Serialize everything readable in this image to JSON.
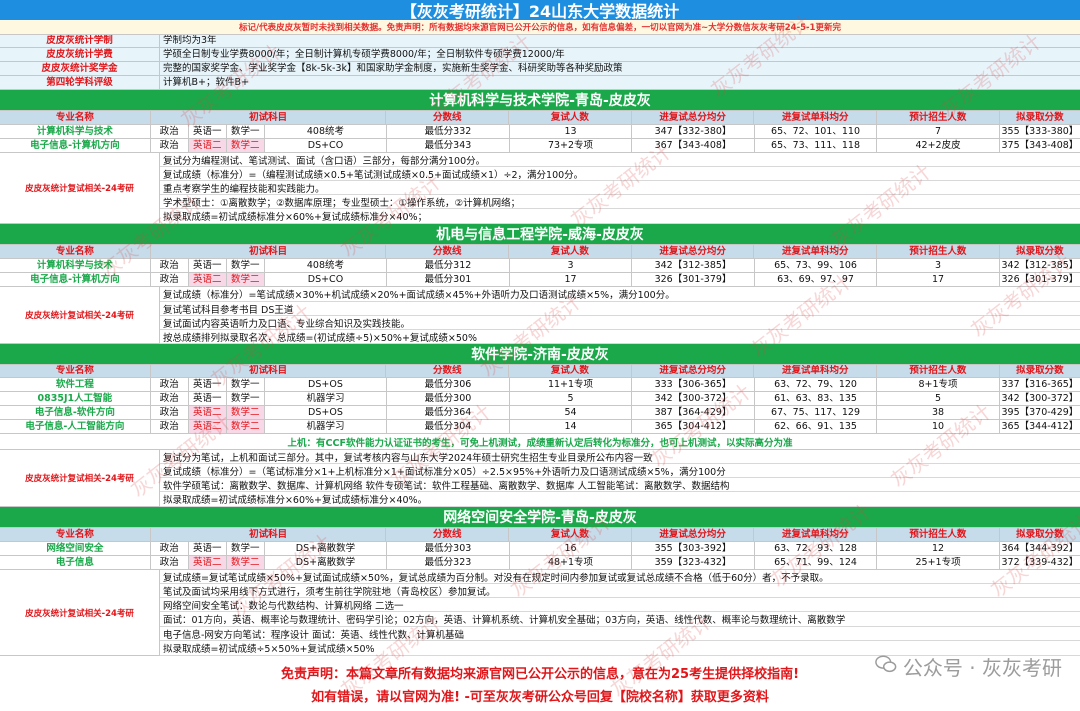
{
  "title": "【灰灰考研统计】24山东大学数据统计",
  "notice": "标记/代表皮皮灰暂时未找到相关数据。免责声明：所有数据均来源官网已公开公示的信息，如有信息偏差，一切以官网为准~大学分数信灰灰考研24-5-1更新完",
  "info": [
    {
      "label": "皮皮灰统计学制",
      "value": "学制均为3年"
    },
    {
      "label": "皮皮灰统计学费",
      "value": "学硕全日制专业学费8000/年；全日制计算机专硕学费8000/年；全日制软件专硕学费12000/年"
    },
    {
      "label": "皮皮灰统计奖学金",
      "value": "完整的国家奖学金、学业奖学金【8k-5k-3k】和国家助学金制度，实施新生奖学金、科研奖助等各种奖励政策"
    },
    {
      "label": "第四轮学科评级",
      "value": "计算机B+；软件B+"
    }
  ],
  "headers": {
    "major": "专业名称",
    "exam": "初试科目",
    "line": "分数线",
    "retest_count": "复试人数",
    "total_avg": "进复试总分均分",
    "single_avg": "进复试单科均分",
    "plan": "预计招生人数",
    "admit": "拟录取分数"
  },
  "retest_label": "皮皮灰统计复试相关-24考研",
  "sections": [
    {
      "title": "计算机科学与技术学院-青岛-皮皮灰",
      "rows": [
        {
          "major": "计算机科学与技术",
          "s1": "政治",
          "s2": "英语一",
          "s3": "数学一",
          "s4": "408统考",
          "line": "最低分332",
          "count": "13",
          "total": "347【332-380】",
          "single": "65、72、101、110",
          "plan": "7",
          "admit": "355【333-380】",
          "pink": false
        },
        {
          "major": "电子信息-计算机方向",
          "s1": "政治",
          "s2": "英语二",
          "s3": "数学二",
          "s4": "DS+CO",
          "line": "最低分343",
          "count": "73+2专项",
          "total": "367【343-408】",
          "single": "65、73、111、118",
          "plan": "42+2皮皮",
          "admit": "375【343-408】",
          "pink": true
        }
      ],
      "retest": [
        "复试分为编程测试、笔试测试、面试（含口语）三部分，每部分满分100分。",
        "复试成绩（标准分）=（编程测试成绩×0.5+笔试测试成绩×0.5+面试成绩×1）÷2，满分100分。",
        "重点考察学生的编程技能和实践能力。",
        "学术型硕士：①离散数学；②数据库原理；专业型硕士：①操作系统，②计算机网络；",
        "拟录取成绩=初试成绩标准分×60%+复试成绩标准分×40%；"
      ],
      "note": ""
    },
    {
      "title": "机电与信息工程学院-威海-皮皮灰",
      "rows": [
        {
          "major": "计算机科学与技术",
          "s1": "政治",
          "s2": "英语一",
          "s3": "数学一",
          "s4": "408统考",
          "line": "最低分312",
          "count": "3",
          "total": "342【312-385】",
          "single": "65、73、99、106",
          "plan": "3",
          "admit": "342【312-385】",
          "pink": false
        },
        {
          "major": "电子信息-计算机方向",
          "s1": "政治",
          "s2": "英语二",
          "s3": "数学二",
          "s4": "DS+CO",
          "line": "最低分301",
          "count": "17",
          "total": "326【301-379】",
          "single": "63、69、97、97",
          "plan": "17",
          "admit": "326【301-379】",
          "pink": true
        }
      ],
      "retest": [
        "复试成绩（标准分）=笔试成绩×30%+机试成绩×20%+面试成绩×45%+外语听力及口语测试成绩×5%，满分100分。",
        "复试笔试科目参考书目 DS王道",
        "复试面试内容英语听力及口语、专业综合知识及实践技能。",
        "按总成绩排列拟录取名次，总成绩=(初试成绩÷5)×50%+复试成绩×50%"
      ],
      "note": ""
    },
    {
      "title": "软件学院-济南-皮皮灰",
      "rows": [
        {
          "major": "软件工程",
          "s1": "政治",
          "s2": "英语一",
          "s3": "数学一",
          "s4": "DS+OS",
          "line": "最低分306",
          "count": "11+1专项",
          "total": "333【306-365】",
          "single": "63、72、79、120",
          "plan": "8+1专项",
          "admit": "337【316-365】",
          "pink": false
        },
        {
          "major": "0835J1人工智能",
          "s1": "政治",
          "s2": "英语一",
          "s3": "数学一",
          "s4": "机器学习",
          "line": "最低分300",
          "count": "5",
          "total": "342【300-372】",
          "single": "61、63、83、135",
          "plan": "5",
          "admit": "342【300-372】",
          "pink": false
        },
        {
          "major": "电子信息-软件方向",
          "s1": "政治",
          "s2": "英语二",
          "s3": "数学二",
          "s4": "DS+OS",
          "line": "最低分364",
          "count": "54",
          "total": "387【364-429】",
          "single": "67、75、117、129",
          "plan": "38",
          "admit": "395【370-429】",
          "pink": true
        },
        {
          "major": "电子信息-人工智能方向",
          "s1": "政治",
          "s2": "英语二",
          "s3": "数学二",
          "s4": "机器学习",
          "line": "最低分304",
          "count": "14",
          "total": "365【304-412】",
          "single": "62、66、91、135",
          "plan": "10",
          "admit": "365【344-412】",
          "pink": true
        }
      ],
      "note": "上机：有CCF软件能力认证证书的考生，可免上机测试，成绩重新认定后转化为标准分，也可上机测试，以实际高分为准",
      "retest": [
        "复试分为笔试，上机和面试三部分。其中，复试考核内容与山东大学2024年硕士研究生招生专业目录所公布内容一致",
        "复试成绩（标准分）=（笔试标准分×1+上机标准分×1+面试标准分×05）÷2.5×95%+外语听力及口语测试成绩×5%，满分100分",
        "软件学硕笔试：离散数学、数据库、计算机网络     软件专硕笔试：软件工程基础、离散数学、数据库     人工智能笔试：离散数学、数据结构",
        "拟录取成绩=初试成绩标准分×60%+复试成绩标准分×40%。"
      ]
    },
    {
      "title": "网络空间安全学院-青岛-皮皮灰",
      "rows": [
        {
          "major": "网络空间安全",
          "s1": "政治",
          "s2": "英语一",
          "s3": "数学一",
          "s4": "DS+离散数学",
          "line": "最低分303",
          "count": "16",
          "total": "355【303-392】",
          "single": "63、72、93、128",
          "plan": "12",
          "admit": "364【344-392】",
          "pink": false
        },
        {
          "major": "电子信息",
          "s1": "政治",
          "s2": "英语二",
          "s3": "数学二",
          "s4": "DS+离散数学",
          "line": "最低分323",
          "count": "48+1专项",
          "total": "359【323-432】",
          "single": "65、71、99、124",
          "plan": "25+1专项",
          "admit": "372【339-432】",
          "pink": true
        }
      ],
      "retest": [
        "复试成绩=复试笔试成绩×50%+复试面试成绩×50%，复试总成绩为百分制。对没有在规定时间内参加复试或复试总成绩不合格（低于60分）者，不予录取。",
        "笔试及面试均采用线下方式进行，须考生前往学院驻地（青岛校区）参加复试。",
        "网络空间安全笔试：数论与代数结构、计算机网络 二选一",
        "面试：01方向，英语、概率论与数理统计、密码学引论；02方向，英语、计算机系统、计算机安全基础；03方向，英语、线性代数、概率论与数理统计、离散数学",
        "电子信息-网安方向笔试：程序设计 面试：英语、线性代数、计算机基础",
        "拟录取成绩=初试成绩÷5×50%+复试成绩×50%"
      ],
      "note": ""
    }
  ],
  "footer": {
    "line1": "免责声明：本篇文章所有数据均来源官网已公开公示的信息，意在为25考生提供择校指南!",
    "line2": "如有错误，请以官网为准! -可至灰灰考研公众号回复【院校名称】获取更多资料"
  },
  "brand": "公众号 · 灰灰考研",
  "watermark_text": "灰灰考研统计",
  "colors": {
    "title_bar": "#1e8fe0",
    "section_bar": "#1aa84a",
    "label_red": "#e0161a",
    "major_green": "#1aa84a"
  }
}
